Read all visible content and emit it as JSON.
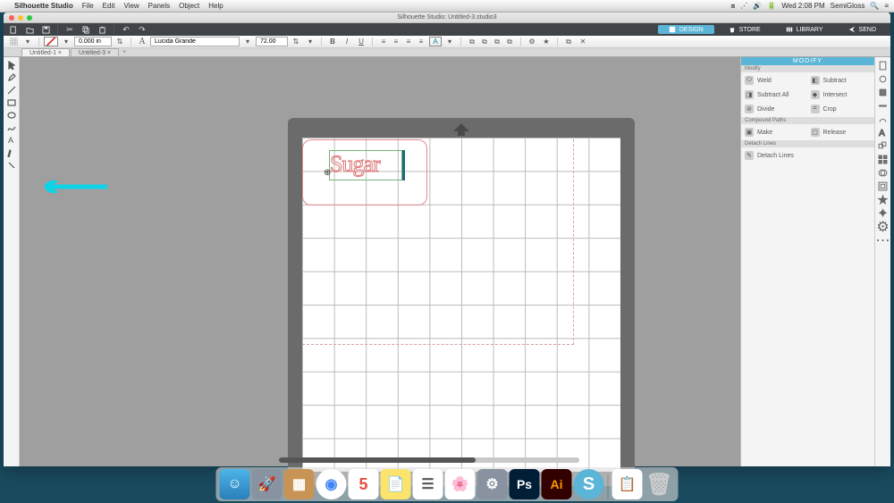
{
  "menubar": {
    "app": "Silhouette Studio",
    "items": [
      "File",
      "Edit",
      "View",
      "Panels",
      "Object",
      "Help"
    ],
    "right": {
      "time": "Wed 2:08 PM",
      "user": "SemiGloss"
    }
  },
  "window": {
    "title": "Silhouette Studio: Untitled-3.studio3"
  },
  "options_bar": {
    "stroke_width": "0.000 in",
    "font_family": "Lucida Grande",
    "font_size": "72.00"
  },
  "doc_tabs": {
    "active": "Untitled-1",
    "inactive": "Untitled-3",
    "add": "+"
  },
  "top_tabs": {
    "design": "DESIGN",
    "store": "STORE",
    "library": "LIBRARY",
    "send": "SEND"
  },
  "canvas": {
    "text_value": "Sugar"
  },
  "modify_panel": {
    "title": "MODIFY",
    "sections": {
      "modify": {
        "head": "Modify",
        "weld": "Weld",
        "subtract": "Subtract",
        "subtract_all": "Subtract All",
        "intersect": "Intersect",
        "divide": "Divide",
        "crop": "Crop"
      },
      "compound": {
        "head": "Compound Paths",
        "make": "Make",
        "release": "Release"
      },
      "detach": {
        "head": "Detach Lines",
        "detach_lines": "Detach Lines"
      }
    }
  }
}
